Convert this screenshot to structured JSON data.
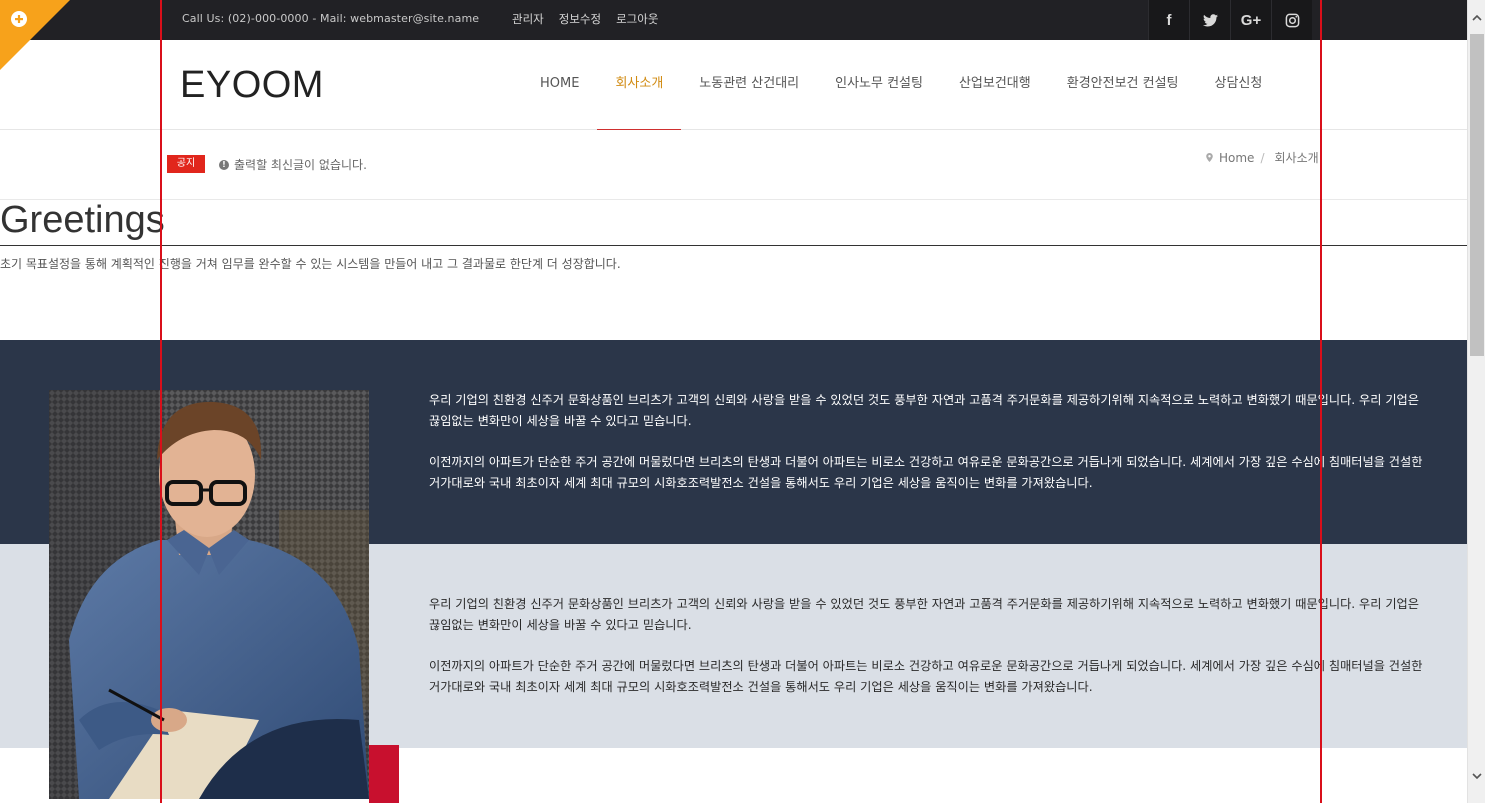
{
  "topbar": {
    "contact": "Call Us: (02)-000-0000 - Mail: webmaster@site.name",
    "links": [
      "관리자",
      "정보수정",
      "로그아웃"
    ],
    "social": [
      {
        "name": "facebook",
        "glyph": "f"
      },
      {
        "name": "twitter",
        "glyph": "t"
      },
      {
        "name": "google-plus",
        "glyph": "G+"
      },
      {
        "name": "instagram",
        "glyph": "◎"
      }
    ]
  },
  "header": {
    "logo": "EYOOM",
    "nav": [
      "HOME",
      "회사소개",
      "노동관련 산건대리",
      "인사노무 컨설팅",
      "산업보건대행",
      "환경안전보건 컨설팅",
      "상담신청"
    ],
    "active_index": 1
  },
  "notice": {
    "tag": "공지",
    "message": "출력할 최신글이 없습니다.",
    "breadcrumb_home": "Home",
    "breadcrumb_sep": "/",
    "breadcrumb_current": "회사소개"
  },
  "greetings": {
    "title": "Greetings",
    "description": "초기 목표설정을 통해 계획적인 진행을 거쳐 임무를 완수할 수 있는 시스템을 만들어 내고 그 결과물로 한단계 더 성장합니다."
  },
  "sections": [
    {
      "p1": "우리 기업의 친환경 신주거 문화상품인 브리츠가 고객의 신뢰와 사랑을 받을 수 있었던 것도 풍부한 자연과 고품격 주거문화를 제공하기위해 지속적으로 노력하고 변화했기 때문입니다. 우리 기업은 끊임없는 변화만이 세상을 바꿀 수 있다고 믿습니다.",
      "p2": "이전까지의 아파트가 단순한 주거 공간에 머물렀다면 브리츠의 탄생과 더불어 아파트는 비로소 건강하고 여유로운 문화공간으로 거듭나게 되었습니다. 세계에서 가장 깊은 수심에 침매터널을 건설한 거가대로와 국내 최초이자 세계 최대 규모의 시화호조력발전소 건설을 통해서도 우리 기업은 세상을 움직이는 변화를 가져왔습니다."
    },
    {
      "p1": "우리 기업의 친환경 신주거 문화상품인 브리츠가 고객의 신뢰와 사랑을 받을 수 있었던 것도 풍부한 자연과 고품격 주거문화를 제공하기위해 지속적으로 노력하고 변화했기 때문입니다. 우리 기업은 끊임없는 변화만이 세상을 바꿀 수 있다고 믿습니다.",
      "p2": "이전까지의 아파트가 단순한 주거 공간에 머물렀다면 브리츠의 탄생과 더불어 아파트는 비로소 건강하고 여유로운 문화공간으로 거듭나게 되었습니다. 세계에서 가장 깊은 수심에 침매터널을 건설한 거가대로와 국내 최초이자 세계 최대 규모의 시화호조력발전소 건설을 통해서도 우리 기업은 세상을 움직이는 변화를 가져왔습니다."
    }
  ],
  "colors": {
    "topbar": "#212125",
    "accent": "#d18b12",
    "notice_tag": "#e1261c",
    "dark_section": "#2b3649",
    "light_section": "#dadfe6",
    "guide_lines": "#d90f1a",
    "corner_ribbon": "#f7a21b"
  },
  "icons": {
    "corner": "plus-circle-icon",
    "notice": "exclamation-circle-icon",
    "breadcrumb": "map-marker-icon",
    "scroll_up": "chevron-up-icon",
    "scroll_down": "chevron-down-icon"
  }
}
